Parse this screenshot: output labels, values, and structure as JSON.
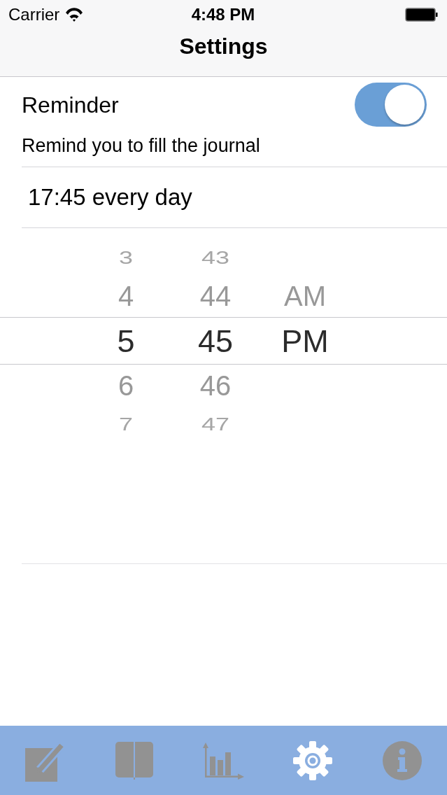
{
  "status_bar": {
    "carrier": "Carrier",
    "time": "4:48 PM"
  },
  "nav_bar": {
    "title": "Settings"
  },
  "reminder": {
    "label": "Reminder",
    "on": true,
    "description": "Remind you to fill the journal"
  },
  "schedule": {
    "text": "17:45 every day"
  },
  "time_picker": {
    "columns": [
      {
        "items": [
          {
            "text": "3",
            "selected": false
          },
          {
            "text": "4",
            "selected": false
          },
          {
            "text": "5",
            "selected": true
          },
          {
            "text": "6",
            "selected": false
          },
          {
            "text": "7",
            "selected": false
          }
        ]
      },
      {
        "items": [
          {
            "text": "43",
            "selected": false
          },
          {
            "text": "44",
            "selected": false
          },
          {
            "text": "45",
            "selected": true
          },
          {
            "text": "46",
            "selected": false
          },
          {
            "text": "47",
            "selected": false
          }
        ]
      },
      {
        "items": [
          {
            "text": "AM",
            "selected": false
          },
          {
            "text": "PM",
            "selected": true
          }
        ]
      }
    ]
  },
  "tab_bar": {
    "items": [
      {
        "kind": "compose",
        "selected": false
      },
      {
        "kind": "journal",
        "selected": false
      },
      {
        "kind": "chart",
        "selected": false
      },
      {
        "kind": "settings",
        "selected": true
      },
      {
        "kind": "info",
        "selected": false
      }
    ]
  }
}
